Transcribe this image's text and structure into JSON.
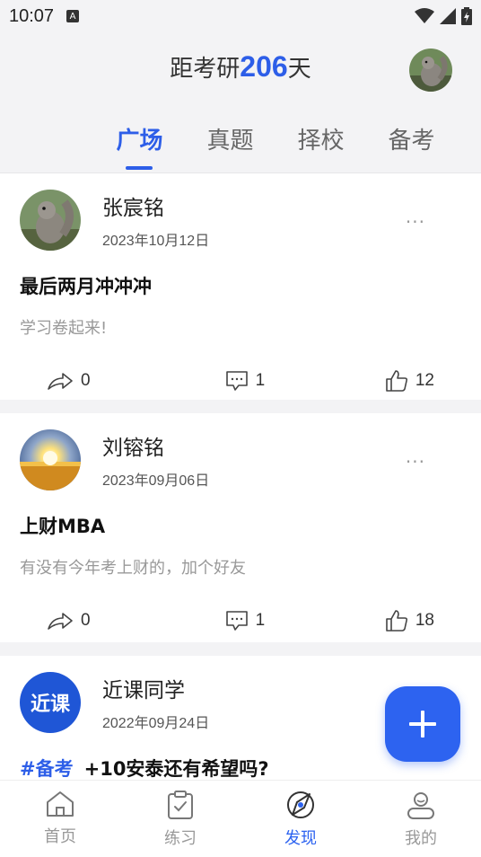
{
  "status_bar": {
    "time": "10:07",
    "notification_icon": "A"
  },
  "header": {
    "countdown_prefix": "距考研",
    "countdown_days": "206",
    "countdown_suffix": "天",
    "avatar_icon": "squirrel-avatar"
  },
  "tabs": [
    {
      "label": "广场",
      "active": true
    },
    {
      "label": "真题",
      "active": false
    },
    {
      "label": "择校",
      "active": false
    },
    {
      "label": "备考",
      "active": false
    }
  ],
  "posts": [
    {
      "author": "张宸铭",
      "date": "2023年10月12日",
      "title": "最后两月冲冲冲",
      "body": "学习卷起来!",
      "shares": "0",
      "comments": "1",
      "likes": "12",
      "avatar": "squirrel-avatar"
    },
    {
      "author": "刘镕铭",
      "date": "2023年09月06日",
      "title": "上财MBA",
      "body": "有没有今年考上财的，加个好友",
      "shares": "0",
      "comments": "1",
      "likes": "18",
      "avatar": "sunset-field-avatar"
    },
    {
      "author": "近课同学",
      "date": "2022年09月24日",
      "topic": "#备考",
      "title": "+10安泰还有希望吗?",
      "avatar": "brand-logo-avatar",
      "avatar_text": "近课"
    }
  ],
  "more_label": "···",
  "bottom_nav": [
    {
      "label": "首页",
      "icon": "home-icon",
      "active": false
    },
    {
      "label": "练习",
      "icon": "clipboard-check-icon",
      "active": false
    },
    {
      "label": "发现",
      "icon": "compass-icon",
      "active": true
    },
    {
      "label": "我的",
      "icon": "user-icon",
      "active": false
    }
  ],
  "colors": {
    "accent": "#2d5ee8",
    "fab": "#2d63f0",
    "muted": "#999999"
  }
}
